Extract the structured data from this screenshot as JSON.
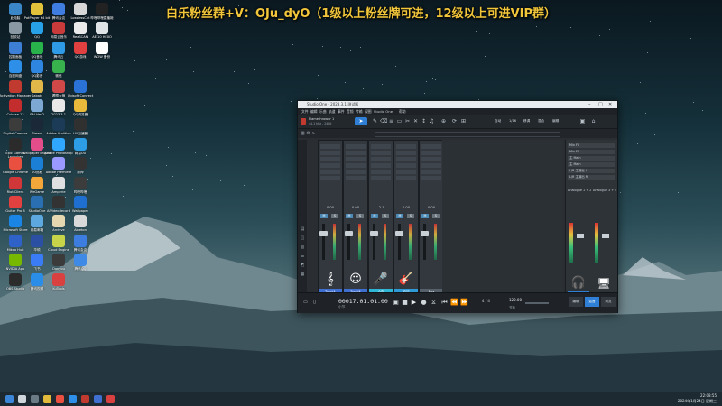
{
  "overlay_title": "白乐粉丝群+V：OJu_dyO（1级以上粉丝牌可进，12级以上可进VIP群）",
  "desktop_icons": [
    {
      "label": "此电脑",
      "color": "#3a86c7"
    },
    {
      "label": "PotPlayer 64 bit",
      "color": "#e2c23a"
    },
    {
      "label": "腾讯会议",
      "color": "#3f7de0"
    },
    {
      "label": "LosslessCut",
      "color": "#d7d7d7"
    },
    {
      "label": "哔哩哔哩直播姬",
      "color": "#222"
    },
    {
      "label": "回收站",
      "color": "#8a98a3"
    },
    {
      "label": "QQ",
      "color": "#27a0e8"
    },
    {
      "label": "网易云音乐",
      "color": "#c93a3a"
    },
    {
      "label": "ReaSCAN",
      "color": "#eaeaea"
    },
    {
      "label": "AE 10 HEXO",
      "color": "#dfe3e6"
    },
    {
      "label": "控制面板",
      "color": "#3d7fd4"
    },
    {
      "label": "QQ音乐",
      "color": "#28b44a"
    },
    {
      "label": "腾讯云",
      "color": "#2f9be6"
    },
    {
      "label": "QQ游戏",
      "color": "#e04040"
    },
    {
      "label": "WOW 备份",
      "color": "#ffffff"
    },
    {
      "label": "百度网盘",
      "color": "#2d8fe8"
    },
    {
      "label": "QQ影音",
      "color": "#2f86e0"
    },
    {
      "label": "微信",
      "color": "#37b24d"
    },
    {
      "label": "Activation Manager",
      "color": "#c03a2f"
    },
    {
      "label": "Sabaki",
      "color": "#e0b84a"
    },
    {
      "label": "看图大师",
      "color": "#d04848"
    },
    {
      "label": "Ubisoft Connect",
      "color": "#2a72d6"
    },
    {
      "label": "Cubase 13",
      "color": "#c42d2d"
    },
    {
      "label": "SAI Ver.2",
      "color": "#7ea8d4"
    },
    {
      "label": "2023.3.1",
      "color": "#e8e8e8"
    },
    {
      "label": "QQ浏览器",
      "color": "#e8b93b"
    },
    {
      "label": "Digital Camera",
      "color": "#3c3c3c"
    },
    {
      "label": "Steam",
      "color": "#1b2838"
    },
    {
      "label": "Adobe Audition",
      "color": "#1c3b56"
    },
    {
      "label": "UU加速器",
      "color": "#303030"
    },
    {
      "label": "Epic Games Launcher",
      "color": "#2b2b2b"
    },
    {
      "label": "Wallpaper Engine",
      "color": "#e34d8a"
    },
    {
      "label": "Adobe Photoshop",
      "color": "#31a8ff"
    },
    {
      "label": "网易UU",
      "color": "#2d9de6"
    },
    {
      "label": "Google Chrome",
      "color": "#e9503f"
    },
    {
      "label": "UU远程",
      "color": "#1c7fd6"
    },
    {
      "label": "Adobe Premiere",
      "color": "#9999ff"
    },
    {
      "label": "原神",
      "color": "#333"
    },
    {
      "label": "Riot Client",
      "color": "#d13639"
    },
    {
      "label": "WeGame",
      "color": "#f3a63a"
    },
    {
      "label": "Amperie",
      "color": "#e0e0e0"
    },
    {
      "label": "哔哩哔哩",
      "color": "#3c3c3c"
    },
    {
      "label": "Guitar Pro 8",
      "color": "#e34040"
    },
    {
      "label": "StudioOne",
      "color": "#2b6fb3"
    },
    {
      "label": "AIVideoRecord",
      "color": "#333"
    },
    {
      "label": "Wallpaper",
      "color": "#1f6fd1"
    },
    {
      "label": "Microsoft Store",
      "color": "#1b85e6"
    },
    {
      "label": "网易邮箱",
      "color": "#5ea8e0"
    },
    {
      "label": "Archive",
      "color": "#e7d7b0"
    },
    {
      "label": "Ableton",
      "color": "#d9d9d9"
    },
    {
      "label": "Mikoo Hub",
      "color": "#2e62c8"
    },
    {
      "label": "华硕",
      "color": "#2b4fa3"
    },
    {
      "label": "Cloud Engine",
      "color": "#c7d44a"
    },
    {
      "label": "腾讯会议",
      "color": "#3d7de0"
    },
    {
      "label": "NVIDIA App",
      "color": "#76b900"
    },
    {
      "label": "飞书",
      "color": "#3a7cf5"
    },
    {
      "label": "Danyou",
      "color": "#3b3b3b"
    },
    {
      "label": "腾讯QQ",
      "color": "#3e8ae6"
    },
    {
      "label": "OBS Studio",
      "color": "#2b2b2b"
    },
    {
      "label": "腾讯视频",
      "color": "#2a8ee8"
    },
    {
      "label": "KuTools",
      "color": "#d94040"
    }
  ],
  "window": {
    "title": "Studio One - 2023.3.1 测试版",
    "menu": [
      "文件",
      "编辑",
      "乐曲",
      "轨道",
      "事件",
      "音频",
      "传输",
      "视图",
      "Studio One",
      "帮助"
    ],
    "song_name": "Flamethrower 1",
    "song_sub": "44.1 kHz - 24bit",
    "toolbar_right_labels": [
      "自动",
      "1/16",
      "移调",
      "混合",
      "编辑"
    ],
    "channels": [
      {
        "name": "Track1",
        "color": "#3e6fd1",
        "vol": "0.00",
        "icon": "𝄞"
      },
      {
        "name": "Track2",
        "color": "#3e6fd1",
        "vol": "0.00",
        "icon": "☺"
      },
      {
        "name": "人声",
        "color": "#2fb5d6",
        "vol": "-2.1",
        "icon": "🎤"
      },
      {
        "name": "吉他",
        "color": "#2f9bd6",
        "vol": "0.00",
        "icon": "🎸"
      },
      {
        "name": "Bus",
        "color": "#55606a",
        "vol": "0.00",
        "icon": ""
      }
    ],
    "right_panel": {
      "items": [
        "Mix FX",
        "Mix FX",
        "主 Main",
        "主 Main",
        "L/R 主输出 L",
        "L/R 主输出 R"
      ],
      "section_a": "Analogue 1 + 2",
      "section_b": "Analogue 3 + 4",
      "label_a": "音频",
      "label_b": "主输出"
    },
    "transport": {
      "timecode": "00017.01.01.00",
      "timeunit": "小节",
      "signature": "4 / 4",
      "tempo": "120.00",
      "tempo_label": "节拍",
      "buttons": [
        "编辑",
        "混音",
        "浏览"
      ]
    }
  },
  "taskbar": {
    "time": "22:08:55",
    "date": "2024年1月24日 星期三"
  }
}
